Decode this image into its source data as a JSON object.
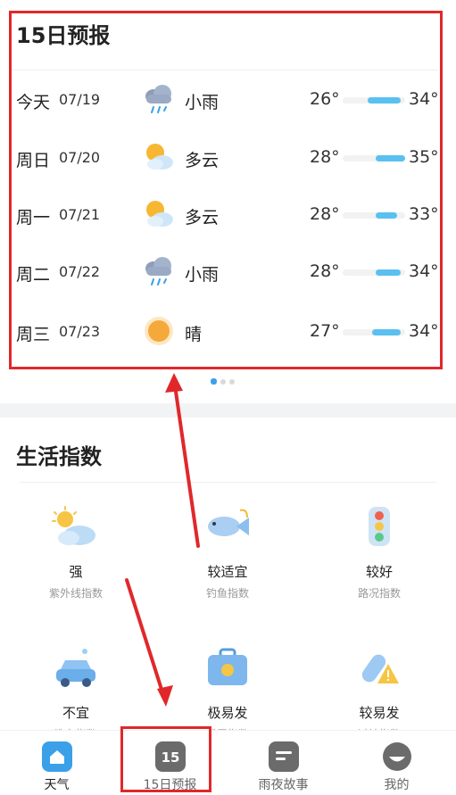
{
  "forecast": {
    "title": "15日预报",
    "days": [
      {
        "day": "今天",
        "date": "07/19",
        "icon": "light-rain-icon",
        "condition": "小雨",
        "low": "26°",
        "high": "34°",
        "low_value": 26,
        "high_value": 34
      },
      {
        "day": "周日",
        "date": "07/20",
        "icon": "partly-cloudy-icon",
        "condition": "多云",
        "low": "28°",
        "high": "35°",
        "low_value": 28,
        "high_value": 35
      },
      {
        "day": "周一",
        "date": "07/21",
        "icon": "partly-cloudy-icon",
        "condition": "多云",
        "low": "28°",
        "high": "33°",
        "low_value": 28,
        "high_value": 33
      },
      {
        "day": "周二",
        "date": "07/22",
        "icon": "light-rain-icon",
        "condition": "小雨",
        "low": "28°",
        "high": "34°",
        "low_value": 28,
        "high_value": 34
      },
      {
        "day": "周三",
        "date": "07/23",
        "icon": "sunny-icon",
        "condition": "晴",
        "low": "27°",
        "high": "34°",
        "low_value": 27,
        "high_value": 34
      }
    ],
    "page_count": 3,
    "active_page": 0
  },
  "life": {
    "title": "生活指数",
    "items": [
      {
        "icon": "sun-cloud-icon",
        "value": "强",
        "label": "紫外线指数"
      },
      {
        "icon": "fish-icon",
        "value": "较适宜",
        "label": "钓鱼指数"
      },
      {
        "icon": "traffic-light-icon",
        "value": "较好",
        "label": "路况指数"
      },
      {
        "icon": "car-wash-icon",
        "value": "不宜",
        "label": "洗车指数"
      },
      {
        "icon": "medical-kit-icon",
        "value": "极易发",
        "label": "感冒指数"
      },
      {
        "icon": "allergy-pill-icon",
        "value": "较易发",
        "label": "过敏指数"
      }
    ]
  },
  "tabbar": {
    "tabs": [
      {
        "label": "天气",
        "icon": "home-icon"
      },
      {
        "label": "15日预报",
        "icon": "calendar-15-icon",
        "badge": "15"
      },
      {
        "label": "雨夜故事",
        "icon": "story-icon"
      },
      {
        "label": "我的",
        "icon": "profile-icon"
      }
    ],
    "active": 0
  },
  "colors": {
    "accent": "#3aa0e8",
    "temp_bar": "#5ac0f0",
    "highlight": "#e0282b"
  }
}
